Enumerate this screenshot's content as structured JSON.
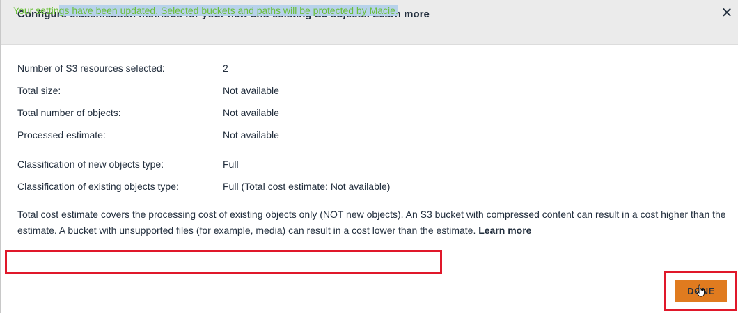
{
  "header": {
    "title": "Configure classification methods for your new and existing S3 objects. Learn more"
  },
  "details": [
    {
      "label": "Number of S3 resources selected:",
      "value": "2"
    },
    {
      "label": "Total size:",
      "value": "Not available"
    },
    {
      "label": "Total number of objects:",
      "value": "Not available"
    },
    {
      "label": "Processed estimate:",
      "value": "Not available"
    },
    {
      "label": "Classification of new objects type:",
      "value": "Full"
    },
    {
      "label": "Classification of existing objects type:",
      "value": "Full (Total cost estimate: Not available)"
    }
  ],
  "note": {
    "text": "Total cost estimate covers the processing cost of existing objects only (NOT new objects). An S3 bucket with compressed content can result in a cost higher than the estimate. A bucket with unsupported files (for example, media) can result in a cost lower than the estimate.",
    "learn_more": "Learn more"
  },
  "status": {
    "message_start": "Your settin",
    "message_highlighted": "gs have been updated. Selected buckets and paths will be protected by Macie."
  },
  "footer": {
    "done_label": "DONE"
  },
  "icons": {
    "close": "close-icon",
    "cursor": "hand-cursor-icon"
  },
  "colors": {
    "header_bg": "#ebebeb",
    "success_text": "#6abf3a",
    "highlight": "#b7d2ea",
    "annotation_red": "#e0182a",
    "primary_button": "#e07b1f"
  }
}
